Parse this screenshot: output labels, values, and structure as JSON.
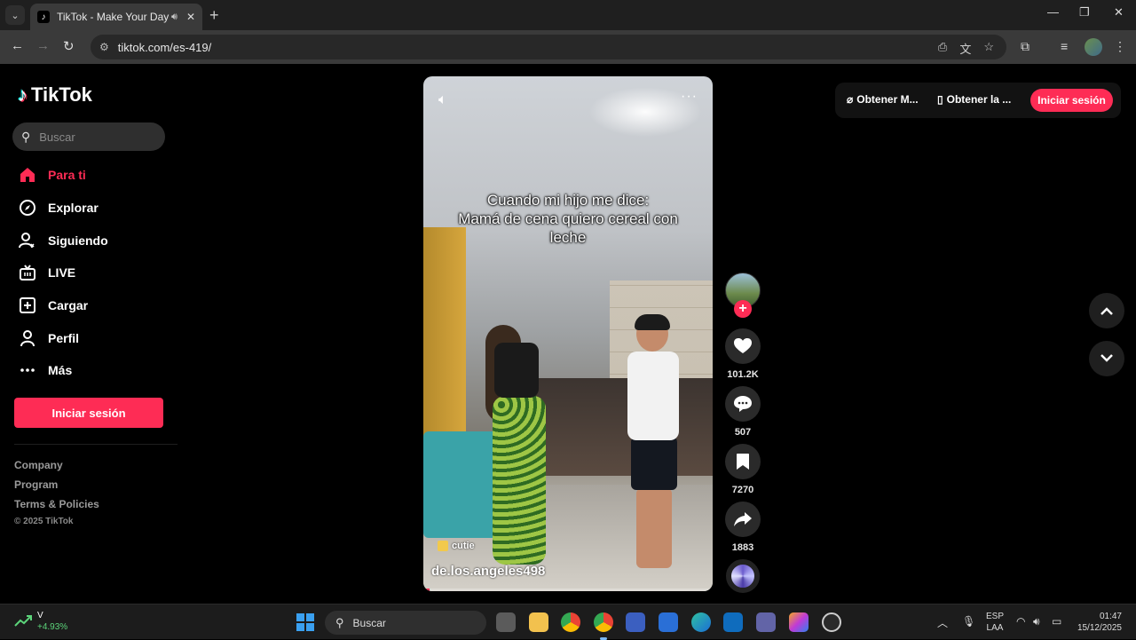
{
  "browser": {
    "tab_title": "TikTok - Make Your Day",
    "url": "tiktok.com/es-419/"
  },
  "sidebar": {
    "logo_text": "TikTok",
    "search_placeholder": "Buscar",
    "nav": [
      {
        "label": "Para ti",
        "icon": "home-icon",
        "active": true
      },
      {
        "label": "Explorar",
        "icon": "compass-icon",
        "active": false
      },
      {
        "label": "Siguiendo",
        "icon": "following-icon",
        "active": false
      },
      {
        "label": "LIVE",
        "icon": "live-icon",
        "active": false
      },
      {
        "label": "Cargar",
        "icon": "upload-icon",
        "active": false
      },
      {
        "label": "Perfil",
        "icon": "profile-icon",
        "active": false
      },
      {
        "label": "Más",
        "icon": "more-icon",
        "active": false
      }
    ],
    "login_label": "Iniciar sesión",
    "footer_links": [
      "Company",
      "Program",
      "Terms & Policies"
    ],
    "copyright": "© 2025 TikTok"
  },
  "video": {
    "caption": [
      "Cuando mi hijo me dice:",
      "Mamá de cena quiero cereal con",
      "leche"
    ],
    "music": "cutie",
    "author": "de.los.angeles498",
    "progress": 0.02
  },
  "actions": {
    "likes": "101.2K",
    "comments": "507",
    "saves": "7270",
    "shares": "1883"
  },
  "topbar": {
    "get_app_1": "Obtener M...",
    "get_app_2": "Obtener la ...",
    "login": "Iniciar sesión"
  },
  "taskbar": {
    "stock_symbol": "V",
    "stock_change": "+4.93%",
    "search_label": "Buscar",
    "lang_1": "ESP",
    "lang_2": "LAA",
    "time": "01:47",
    "date": "15/12/2025"
  },
  "colors": {
    "accent": "#fe2c55",
    "background": "#000000"
  }
}
